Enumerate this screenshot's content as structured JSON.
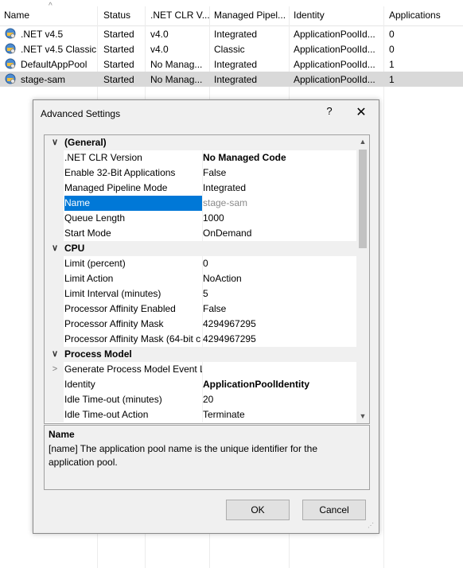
{
  "list": {
    "columns": [
      "Name",
      "Status",
      ".NET CLR V...",
      "Managed Pipel...",
      "Identity",
      "Applications"
    ],
    "rows": [
      {
        "name": ".NET v4.5",
        "status": "Started",
        "clr": "v4.0",
        "pipeline": "Integrated",
        "identity": "ApplicationPoolId...",
        "apps": "0"
      },
      {
        "name": ".NET v4.5 Classic",
        "status": "Started",
        "clr": "v4.0",
        "pipeline": "Classic",
        "identity": "ApplicationPoolId...",
        "apps": "0"
      },
      {
        "name": "DefaultAppPool",
        "status": "Started",
        "clr": "No Manag...",
        "pipeline": "Integrated",
        "identity": "ApplicationPoolId...",
        "apps": "1"
      },
      {
        "name": "stage-sam",
        "status": "Started",
        "clr": "No Manag...",
        "pipeline": "Integrated",
        "identity": "ApplicationPoolId...",
        "apps": "1"
      }
    ],
    "selected_row": 3,
    "icons": {
      "pool": "app-pool-icon",
      "sort": "sort-ascending-icon"
    }
  },
  "dialog": {
    "title": "Advanced Settings",
    "help": "?",
    "close": "✕",
    "properties": [
      {
        "kind": "cat",
        "label": "(General)"
      },
      {
        "kind": "prop",
        "label": ".NET CLR Version",
        "value": "No Managed Code",
        "bold": true
      },
      {
        "kind": "prop",
        "label": "Enable 32-Bit Applications",
        "value": "False"
      },
      {
        "kind": "prop",
        "label": "Managed Pipeline Mode",
        "value": "Integrated"
      },
      {
        "kind": "prop",
        "label": "Name",
        "value": "stage-sam",
        "selected": true
      },
      {
        "kind": "prop",
        "label": "Queue Length",
        "value": "1000"
      },
      {
        "kind": "prop",
        "label": "Start Mode",
        "value": "OnDemand"
      },
      {
        "kind": "cat",
        "label": "CPU"
      },
      {
        "kind": "prop",
        "label": "Limit (percent)",
        "value": "0"
      },
      {
        "kind": "prop",
        "label": "Limit Action",
        "value": "NoAction"
      },
      {
        "kind": "prop",
        "label": "Limit Interval (minutes)",
        "value": "5"
      },
      {
        "kind": "prop",
        "label": "Processor Affinity Enabled",
        "value": "False"
      },
      {
        "kind": "prop",
        "label": "Processor Affinity Mask",
        "value": "4294967295"
      },
      {
        "kind": "prop",
        "label": "Processor Affinity Mask (64-bit c",
        "value": "4294967295"
      },
      {
        "kind": "cat",
        "label": "Process Model"
      },
      {
        "kind": "prop",
        "label": "Generate Process Model Event L",
        "value": "",
        "expandable": true
      },
      {
        "kind": "prop",
        "label": "Identity",
        "value": "ApplicationPoolIdentity",
        "bold": true
      },
      {
        "kind": "prop",
        "label": "Idle Time-out (minutes)",
        "value": "20"
      },
      {
        "kind": "prop",
        "label": "Idle Time-out Action",
        "value": "Terminate"
      }
    ],
    "description": {
      "title": "Name",
      "text": "[name] The application pool name is the unique identifier for the application pool."
    },
    "ok_label": "OK",
    "cancel_label": "Cancel",
    "colors": {
      "selection": "#0078d7",
      "row_selected": "#d9d9d9"
    }
  }
}
